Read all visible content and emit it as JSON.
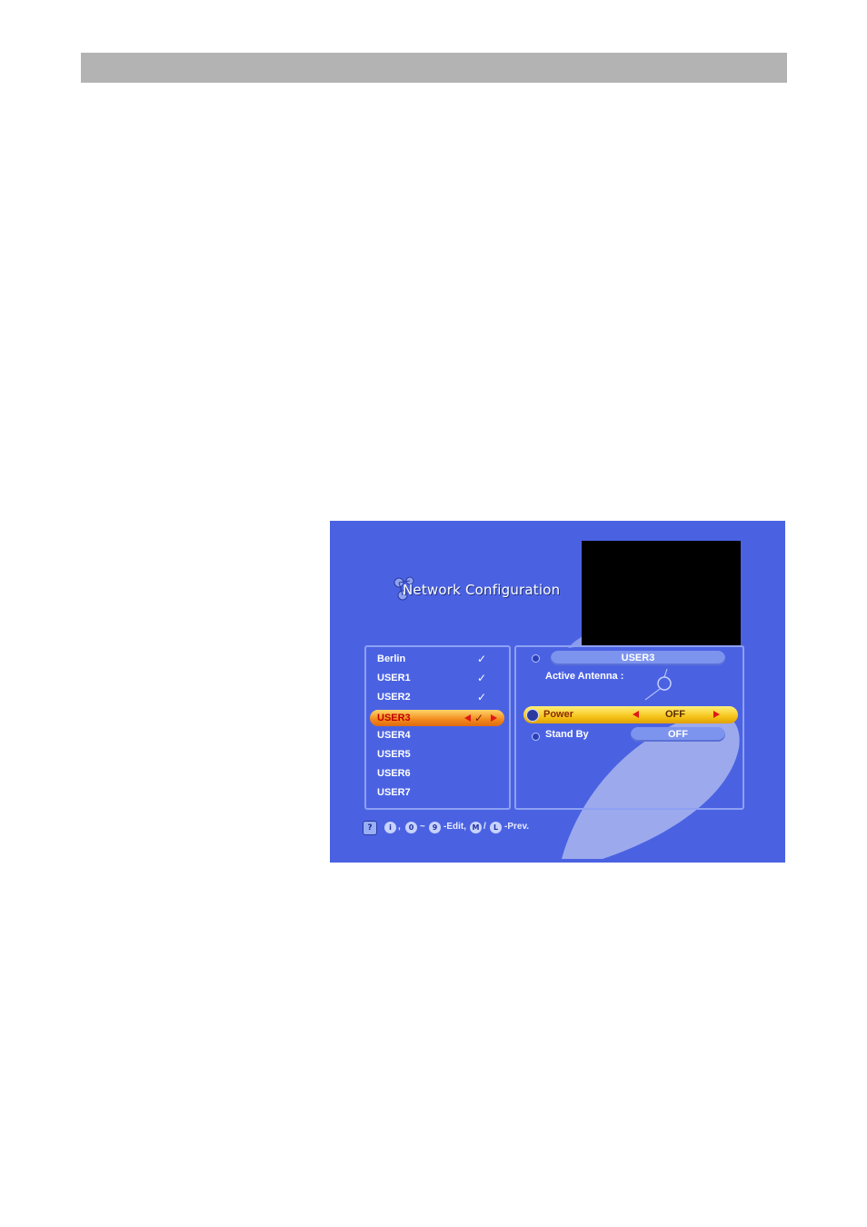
{
  "title": "Network Configuration",
  "list": {
    "items": [
      {
        "label": "Berlin",
        "checked": true
      },
      {
        "label": "USER1",
        "checked": true
      },
      {
        "label": "USER2",
        "checked": true
      },
      {
        "label": "USER3",
        "checked": true,
        "selected": true
      },
      {
        "label": "USER4",
        "checked": false
      },
      {
        "label": "USER5",
        "checked": false
      },
      {
        "label": "USER6",
        "checked": false
      },
      {
        "label": "USER7",
        "checked": false
      }
    ],
    "check_glyph": "✓"
  },
  "detail": {
    "name": "USER3",
    "active_antenna_label": "Active Antenna :",
    "power_label": "Power",
    "power_value": "OFF",
    "standby_label": "Stand By",
    "standby_value": "OFF"
  },
  "help": {
    "sep1": ",",
    "range_sep": "~",
    "edit_text": "-Edit,",
    "slash": "/",
    "prev_text": "-Prev.",
    "key_info": "i",
    "key_0": "0",
    "key_9": "9",
    "key_menu": "M",
    "key_back": "L",
    "help_icon": "?"
  },
  "colors": {
    "screen_bg": "#4a62e2",
    "selection": "#f28a1c",
    "power_highlight": "#f6c51c",
    "arrow": "#e01818"
  }
}
